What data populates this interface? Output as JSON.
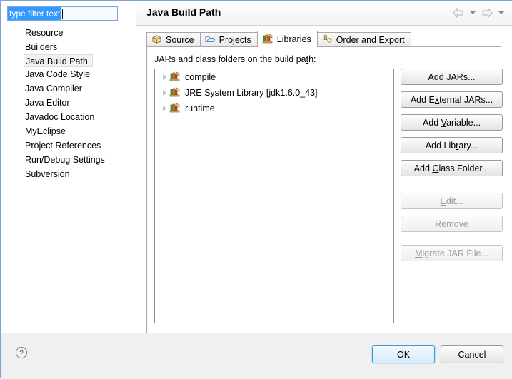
{
  "dialog": {
    "title": "Java Build Path"
  },
  "sidebar": {
    "filter": {
      "value": "type filter text",
      "placeholder": "type filter text"
    },
    "items": [
      {
        "label": "Resource",
        "selected": false
      },
      {
        "label": "Builders",
        "selected": false
      },
      {
        "label": "Java Build Path",
        "selected": true
      },
      {
        "label": "Java Code Style",
        "selected": false
      },
      {
        "label": "Java Compiler",
        "selected": false
      },
      {
        "label": "Java Editor",
        "selected": false
      },
      {
        "label": "Javadoc Location",
        "selected": false
      },
      {
        "label": "MyEclipse",
        "selected": false
      },
      {
        "label": "Project References",
        "selected": false
      },
      {
        "label": "Run/Debug Settings",
        "selected": false
      },
      {
        "label": "Subversion",
        "selected": false
      }
    ]
  },
  "header": {
    "title": "Java Build Path",
    "nav": [
      {
        "name": "back-arrow-icon",
        "enabled": false
      },
      {
        "name": "back-dropdown-icon",
        "enabled": true
      },
      {
        "name": "forward-arrow-icon",
        "enabled": false
      },
      {
        "name": "forward-dropdown-icon",
        "enabled": true
      }
    ]
  },
  "tabs": [
    {
      "label": "Source",
      "icon": "source-package-icon",
      "active": false
    },
    {
      "label": "Projects",
      "icon": "projects-folder-icon",
      "active": false
    },
    {
      "label": "Libraries",
      "icon": "libraries-books-icon",
      "active": true
    },
    {
      "label": "Order and Export",
      "icon": "order-export-icon",
      "active": false
    }
  ],
  "libraries_tab": {
    "list_label_pre": "JARs and class folders on the build pa",
    "list_label_mnemonic": "t",
    "list_label_post": "h:",
    "entries": [
      {
        "label": "compile",
        "icon": "library-icon",
        "expandable": true
      },
      {
        "label": "JRE System Library [jdk1.6.0_43]",
        "icon": "library-icon",
        "expandable": true
      },
      {
        "label": "runtime",
        "icon": "library-icon",
        "expandable": true
      }
    ],
    "buttons": [
      {
        "pre": "Add ",
        "mnemonic": "J",
        "post": "ARs...",
        "enabled": true
      },
      {
        "pre": "Add E",
        "mnemonic": "x",
        "post": "ternal JARs...",
        "enabled": true
      },
      {
        "pre": "Add ",
        "mnemonic": "V",
        "post": "ariable...",
        "enabled": true
      },
      {
        "pre": "Add Lib",
        "mnemonic": "r",
        "post": "ary...",
        "enabled": true
      },
      {
        "pre": "Add ",
        "mnemonic": "C",
        "post": "lass Folder...",
        "enabled": true
      },
      {
        "pre": "",
        "mnemonic": "E",
        "post": "dit...",
        "enabled": false
      },
      {
        "pre": "",
        "mnemonic": "R",
        "post": "emove",
        "enabled": false
      },
      {
        "pre": "",
        "mnemonic": "M",
        "post": "igrate JAR File...",
        "enabled": false
      }
    ]
  },
  "footer": {
    "help_icon": "help-question-icon",
    "ok_label": "OK",
    "cancel_label": "Cancel"
  },
  "colors": {
    "selection_blue": "#3399ff",
    "default_button_border": "#3c9bd7",
    "window_border": "#7da2ce"
  }
}
